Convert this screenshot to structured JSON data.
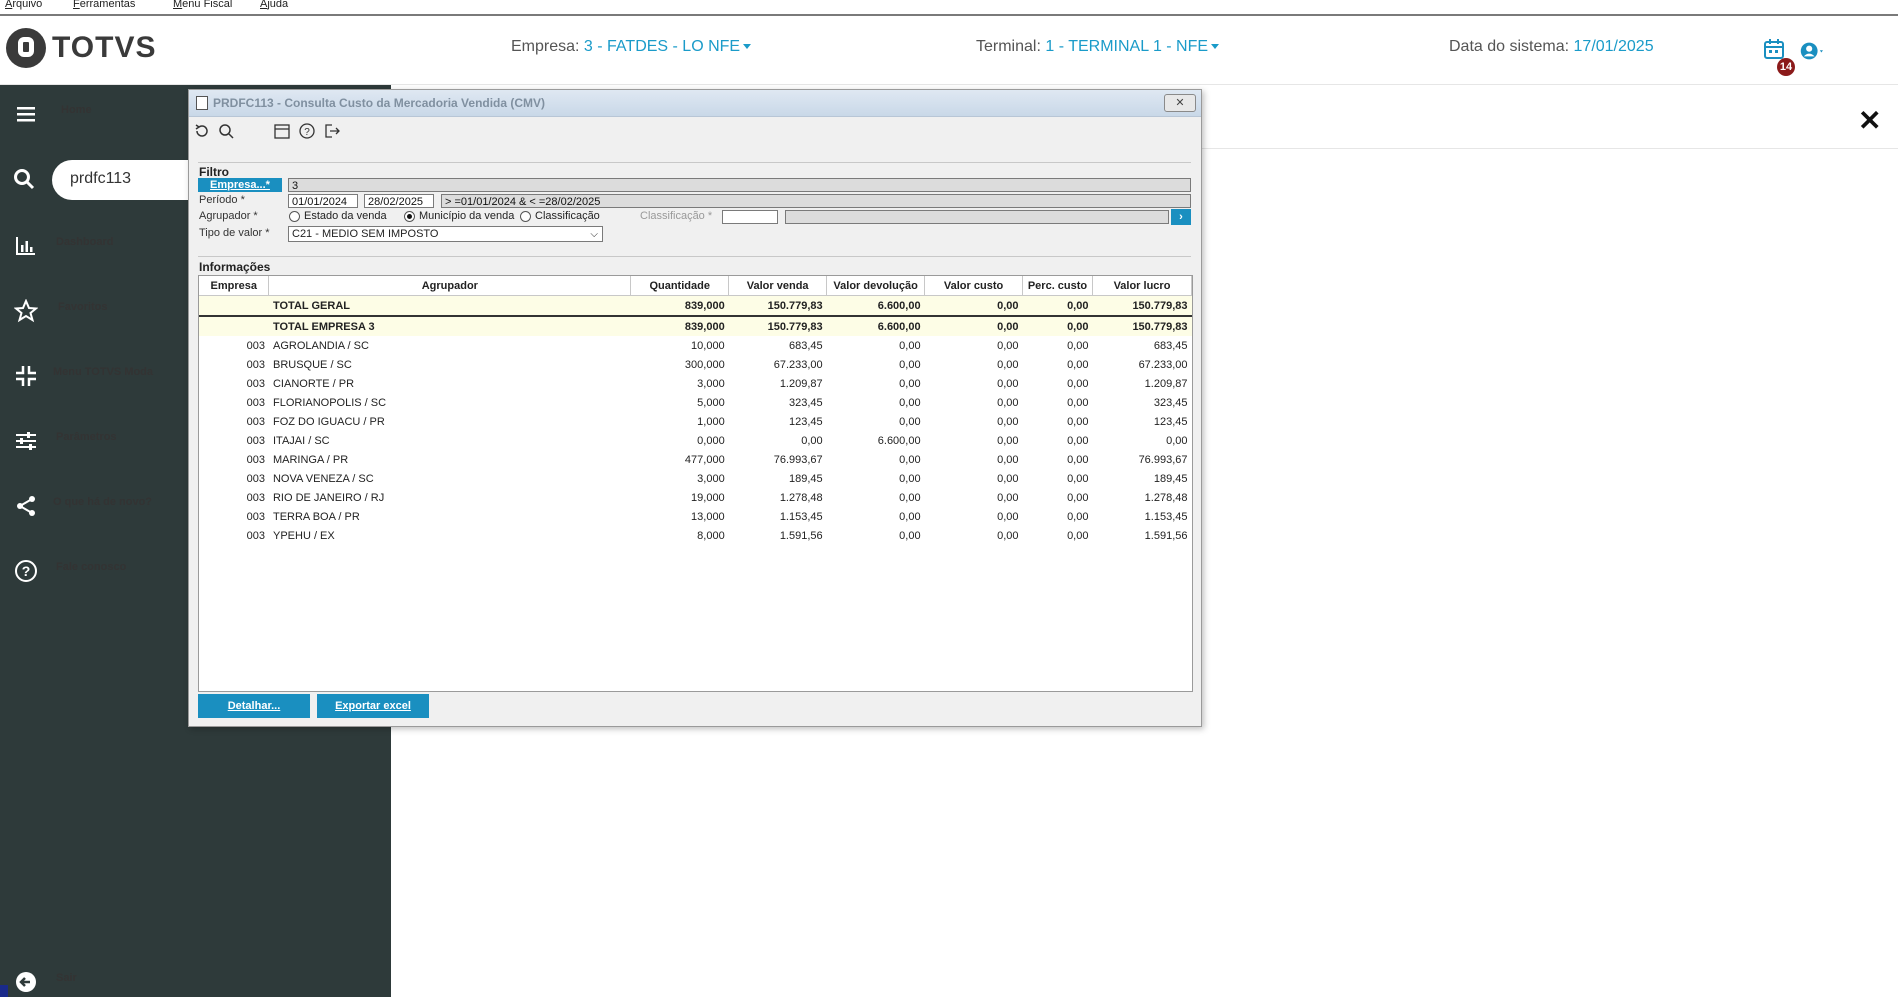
{
  "menubar": [
    "Arquivo",
    "Ferramentas",
    "Menu Fiscal",
    "Ajuda"
  ],
  "header": {
    "logo": "TOTVS",
    "empresa_label": "Empresa:",
    "empresa_value": "3 - FATDES - LO NFE",
    "terminal_label": "Terminal:",
    "terminal_value": "1 - TERMINAL 1 - NFE",
    "data_label": "Data do sistema:",
    "data_value": "17/01/2025",
    "notification_count": "14"
  },
  "sidebar": {
    "items": [
      {
        "label": "Home",
        "icon": "menu-icon"
      },
      {
        "label": "Dashboard",
        "icon": "bar-chart-icon"
      },
      {
        "label": "Favoritos",
        "icon": "star-icon"
      },
      {
        "label": "Menu TOTVS Moda",
        "icon": "compress-icon"
      },
      {
        "label": "Parâmetros",
        "icon": "sliders-icon"
      },
      {
        "label": "O que há de novo?",
        "icon": "share-icon"
      },
      {
        "label": "Fale conosco",
        "icon": "help-icon"
      },
      {
        "label": "Sair",
        "icon": "logout-icon"
      }
    ],
    "search_value": "prdfc113"
  },
  "dialog": {
    "title": "PRDFC113 - Consulta Custo da Mercadoria Vendida (CMV)",
    "close_label": "✕",
    "filtro": {
      "section": "Filtro",
      "empresa_button": "Empresa...*",
      "empresa_value": "3",
      "periodo_label": "Período *",
      "periodo_inicio": "01/01/2024",
      "periodo_fim": "28/02/2025",
      "periodo_expr": "> =01/01/2024 & < =28/02/2025",
      "agrupador_label": "Agrupador *",
      "radio_estado": "Estado da venda",
      "radio_municipio": "Município da venda",
      "radio_classificacao": "Classificação",
      "classificacao_label": "Classificação *",
      "tipo_valor_label": "Tipo de valor *",
      "tipo_valor_value": "C21 - MEDIO SEM IMPOSTO"
    },
    "informacoes": {
      "section": "Informações",
      "columns": [
        "Empresa",
        "Agrupador",
        "Quantidade",
        "Valor venda",
        "Valor devolução",
        "Valor custo",
        "Perc. custo",
        "Valor lucro"
      ],
      "totals": [
        [
          "",
          "TOTAL GERAL",
          "839,000",
          "150.779,83",
          "6.600,00",
          "0,00",
          "0,00",
          "150.779,83"
        ],
        [
          "",
          "TOTAL EMPRESA 3",
          "839,000",
          "150.779,83",
          "6.600,00",
          "0,00",
          "0,00",
          "150.779,83"
        ]
      ],
      "rows": [
        [
          "003",
          "AGROLANDIA / SC",
          "10,000",
          "683,45",
          "0,00",
          "0,00",
          "0,00",
          "683,45"
        ],
        [
          "003",
          "BRUSQUE / SC",
          "300,000",
          "67.233,00",
          "0,00",
          "0,00",
          "0,00",
          "67.233,00"
        ],
        [
          "003",
          "CIANORTE / PR",
          "3,000",
          "1.209,87",
          "0,00",
          "0,00",
          "0,00",
          "1.209,87"
        ],
        [
          "003",
          "FLORIANOPOLIS / SC",
          "5,000",
          "323,45",
          "0,00",
          "0,00",
          "0,00",
          "323,45"
        ],
        [
          "003",
          "FOZ DO IGUACU / PR",
          "1,000",
          "123,45",
          "0,00",
          "0,00",
          "0,00",
          "123,45"
        ],
        [
          "003",
          "ITAJAI / SC",
          "0,000",
          "0,00",
          "6.600,00",
          "0,00",
          "0,00",
          "0,00"
        ],
        [
          "003",
          "MARINGA / PR",
          "477,000",
          "76.993,67",
          "0,00",
          "0,00",
          "0,00",
          "76.993,67"
        ],
        [
          "003",
          "NOVA VENEZA / SC",
          "3,000",
          "189,45",
          "0,00",
          "0,00",
          "0,00",
          "189,45"
        ],
        [
          "003",
          "RIO DE JANEIRO / RJ",
          "19,000",
          "1.278,48",
          "0,00",
          "0,00",
          "0,00",
          "1.278,48"
        ],
        [
          "003",
          "TERRA BOA / PR",
          "13,000",
          "1.153,45",
          "0,00",
          "0,00",
          "0,00",
          "1.153,45"
        ],
        [
          "003",
          "YPEHU / EX",
          "8,000",
          "1.591,56",
          "0,00",
          "0,00",
          "0,00",
          "1.591,56"
        ]
      ]
    },
    "buttons": {
      "detalhar": "Detalhar...",
      "exportar": "Exportar excel"
    }
  },
  "colors": {
    "sidebar": "#2e3a3a",
    "accent": "#1a8fc0",
    "link": "#1a9bc9"
  }
}
